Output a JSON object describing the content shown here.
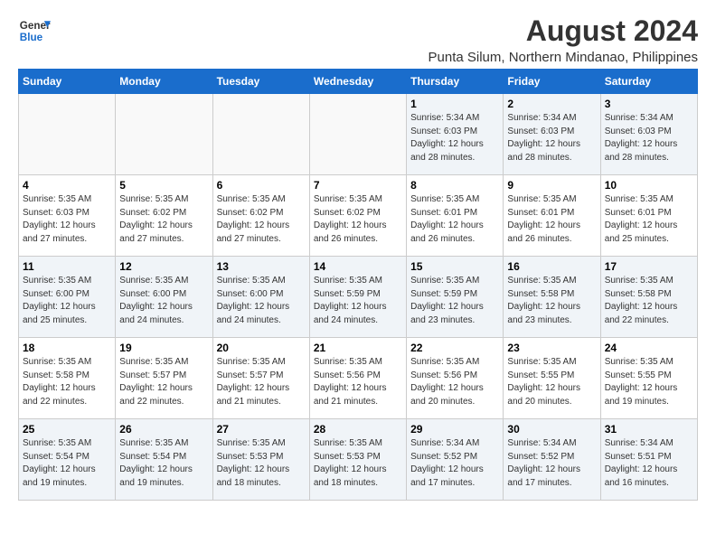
{
  "header": {
    "logo_line1": "General",
    "logo_line2": "Blue",
    "month_year": "August 2024",
    "location": "Punta Silum, Northern Mindanao, Philippines"
  },
  "days_of_week": [
    "Sunday",
    "Monday",
    "Tuesday",
    "Wednesday",
    "Thursday",
    "Friday",
    "Saturday"
  ],
  "weeks": [
    [
      {
        "day": "",
        "info": ""
      },
      {
        "day": "",
        "info": ""
      },
      {
        "day": "",
        "info": ""
      },
      {
        "day": "",
        "info": ""
      },
      {
        "day": "1",
        "info": "Sunrise: 5:34 AM\nSunset: 6:03 PM\nDaylight: 12 hours\nand 28 minutes."
      },
      {
        "day": "2",
        "info": "Sunrise: 5:34 AM\nSunset: 6:03 PM\nDaylight: 12 hours\nand 28 minutes."
      },
      {
        "day": "3",
        "info": "Sunrise: 5:34 AM\nSunset: 6:03 PM\nDaylight: 12 hours\nand 28 minutes."
      }
    ],
    [
      {
        "day": "4",
        "info": "Sunrise: 5:35 AM\nSunset: 6:03 PM\nDaylight: 12 hours\nand 27 minutes."
      },
      {
        "day": "5",
        "info": "Sunrise: 5:35 AM\nSunset: 6:02 PM\nDaylight: 12 hours\nand 27 minutes."
      },
      {
        "day": "6",
        "info": "Sunrise: 5:35 AM\nSunset: 6:02 PM\nDaylight: 12 hours\nand 27 minutes."
      },
      {
        "day": "7",
        "info": "Sunrise: 5:35 AM\nSunset: 6:02 PM\nDaylight: 12 hours\nand 26 minutes."
      },
      {
        "day": "8",
        "info": "Sunrise: 5:35 AM\nSunset: 6:01 PM\nDaylight: 12 hours\nand 26 minutes."
      },
      {
        "day": "9",
        "info": "Sunrise: 5:35 AM\nSunset: 6:01 PM\nDaylight: 12 hours\nand 26 minutes."
      },
      {
        "day": "10",
        "info": "Sunrise: 5:35 AM\nSunset: 6:01 PM\nDaylight: 12 hours\nand 25 minutes."
      }
    ],
    [
      {
        "day": "11",
        "info": "Sunrise: 5:35 AM\nSunset: 6:00 PM\nDaylight: 12 hours\nand 25 minutes."
      },
      {
        "day": "12",
        "info": "Sunrise: 5:35 AM\nSunset: 6:00 PM\nDaylight: 12 hours\nand 24 minutes."
      },
      {
        "day": "13",
        "info": "Sunrise: 5:35 AM\nSunset: 6:00 PM\nDaylight: 12 hours\nand 24 minutes."
      },
      {
        "day": "14",
        "info": "Sunrise: 5:35 AM\nSunset: 5:59 PM\nDaylight: 12 hours\nand 24 minutes."
      },
      {
        "day": "15",
        "info": "Sunrise: 5:35 AM\nSunset: 5:59 PM\nDaylight: 12 hours\nand 23 minutes."
      },
      {
        "day": "16",
        "info": "Sunrise: 5:35 AM\nSunset: 5:58 PM\nDaylight: 12 hours\nand 23 minutes."
      },
      {
        "day": "17",
        "info": "Sunrise: 5:35 AM\nSunset: 5:58 PM\nDaylight: 12 hours\nand 22 minutes."
      }
    ],
    [
      {
        "day": "18",
        "info": "Sunrise: 5:35 AM\nSunset: 5:58 PM\nDaylight: 12 hours\nand 22 minutes."
      },
      {
        "day": "19",
        "info": "Sunrise: 5:35 AM\nSunset: 5:57 PM\nDaylight: 12 hours\nand 22 minutes."
      },
      {
        "day": "20",
        "info": "Sunrise: 5:35 AM\nSunset: 5:57 PM\nDaylight: 12 hours\nand 21 minutes."
      },
      {
        "day": "21",
        "info": "Sunrise: 5:35 AM\nSunset: 5:56 PM\nDaylight: 12 hours\nand 21 minutes."
      },
      {
        "day": "22",
        "info": "Sunrise: 5:35 AM\nSunset: 5:56 PM\nDaylight: 12 hours\nand 20 minutes."
      },
      {
        "day": "23",
        "info": "Sunrise: 5:35 AM\nSunset: 5:55 PM\nDaylight: 12 hours\nand 20 minutes."
      },
      {
        "day": "24",
        "info": "Sunrise: 5:35 AM\nSunset: 5:55 PM\nDaylight: 12 hours\nand 19 minutes."
      }
    ],
    [
      {
        "day": "25",
        "info": "Sunrise: 5:35 AM\nSunset: 5:54 PM\nDaylight: 12 hours\nand 19 minutes."
      },
      {
        "day": "26",
        "info": "Sunrise: 5:35 AM\nSunset: 5:54 PM\nDaylight: 12 hours\nand 19 minutes."
      },
      {
        "day": "27",
        "info": "Sunrise: 5:35 AM\nSunset: 5:53 PM\nDaylight: 12 hours\nand 18 minutes."
      },
      {
        "day": "28",
        "info": "Sunrise: 5:35 AM\nSunset: 5:53 PM\nDaylight: 12 hours\nand 18 minutes."
      },
      {
        "day": "29",
        "info": "Sunrise: 5:34 AM\nSunset: 5:52 PM\nDaylight: 12 hours\nand 17 minutes."
      },
      {
        "day": "30",
        "info": "Sunrise: 5:34 AM\nSunset: 5:52 PM\nDaylight: 12 hours\nand 17 minutes."
      },
      {
        "day": "31",
        "info": "Sunrise: 5:34 AM\nSunset: 5:51 PM\nDaylight: 12 hours\nand 16 minutes."
      }
    ]
  ]
}
